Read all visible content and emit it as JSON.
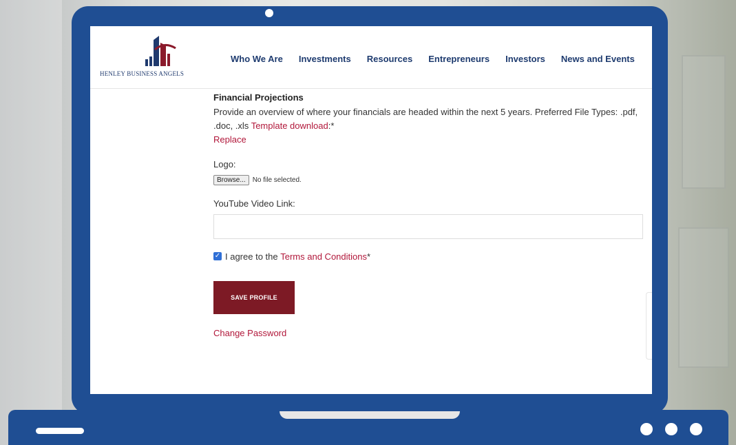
{
  "site": {
    "logo_text": "HENLEY BUSINESS ANGELS",
    "nav": [
      "Who We Are",
      "Investments",
      "Resources",
      "Entrepreneurs",
      "Investors",
      "News and Events"
    ]
  },
  "form": {
    "financial_title": "Financial Projections",
    "financial_desc": "Provide an overview of where your financials are headed within the next 5 years. Preferred File Types: .pdf, .doc, .xls",
    "template_link": "Template download",
    "required_mark": ":*",
    "replace_link": "Replace",
    "logo_label": "Logo:",
    "browse_button": "Browse...",
    "no_file_text": "No file selected.",
    "youtube_label": "YouTube Video Link:",
    "youtube_value": "",
    "agree_prefix": "I agree to the ",
    "terms_link": "Terms and Conditions",
    "terms_required": "*",
    "agree_checked": true,
    "save_button": "SAVE PROFILE",
    "change_password": "Change Password"
  },
  "colors": {
    "laptop_frame": "#1f4e93",
    "link": "#b1173a",
    "save_button_bg": "#7d1a25",
    "nav_text": "#1e3b6f"
  }
}
